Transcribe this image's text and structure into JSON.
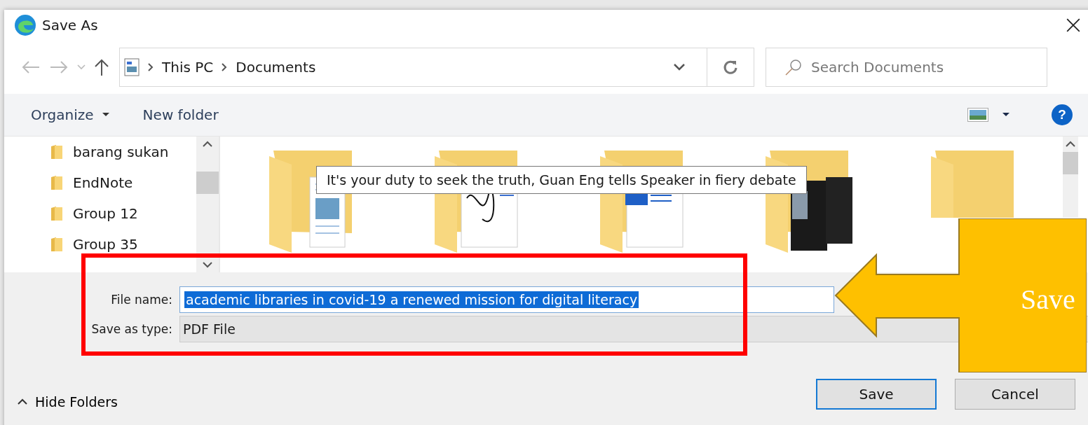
{
  "window": {
    "title": "Save As"
  },
  "address_bar": {
    "path": [
      {
        "label": "This PC"
      },
      {
        "label": "Documents"
      }
    ]
  },
  "search": {
    "placeholder": "Search Documents"
  },
  "toolbar": {
    "items": [
      {
        "label": "Organize",
        "dropdown": true
      },
      {
        "label": "New folder",
        "dropdown": false
      }
    ]
  },
  "help": {
    "label": "?"
  },
  "sidebar": {
    "items": [
      {
        "label": "barang sukan"
      },
      {
        "label": "EndNote"
      },
      {
        "label": "Group 12"
      },
      {
        "label": "Group 35"
      }
    ]
  },
  "folders": [
    {
      "kind": "document"
    },
    {
      "kind": "signature"
    },
    {
      "kind": "word"
    },
    {
      "kind": "photo"
    },
    {
      "kind": "empty"
    }
  ],
  "tooltip": "It's your duty to seek the truth, Guan Eng tells Speaker in fiery debate",
  "form": {
    "file_name_label": "File name:",
    "file_name": "academic libraries in covid-19 a renewed mission for digital literacy",
    "file_name_selected": true,
    "type_label": "Save as type:",
    "type_value": "PDF File"
  },
  "footer": {
    "hide_folders": "Hide Folders",
    "buttons": [
      {
        "label": "Save",
        "default": true
      },
      {
        "label": "Cancel",
        "default": false
      }
    ]
  },
  "annotation": {
    "arrow_text": "Save"
  }
}
